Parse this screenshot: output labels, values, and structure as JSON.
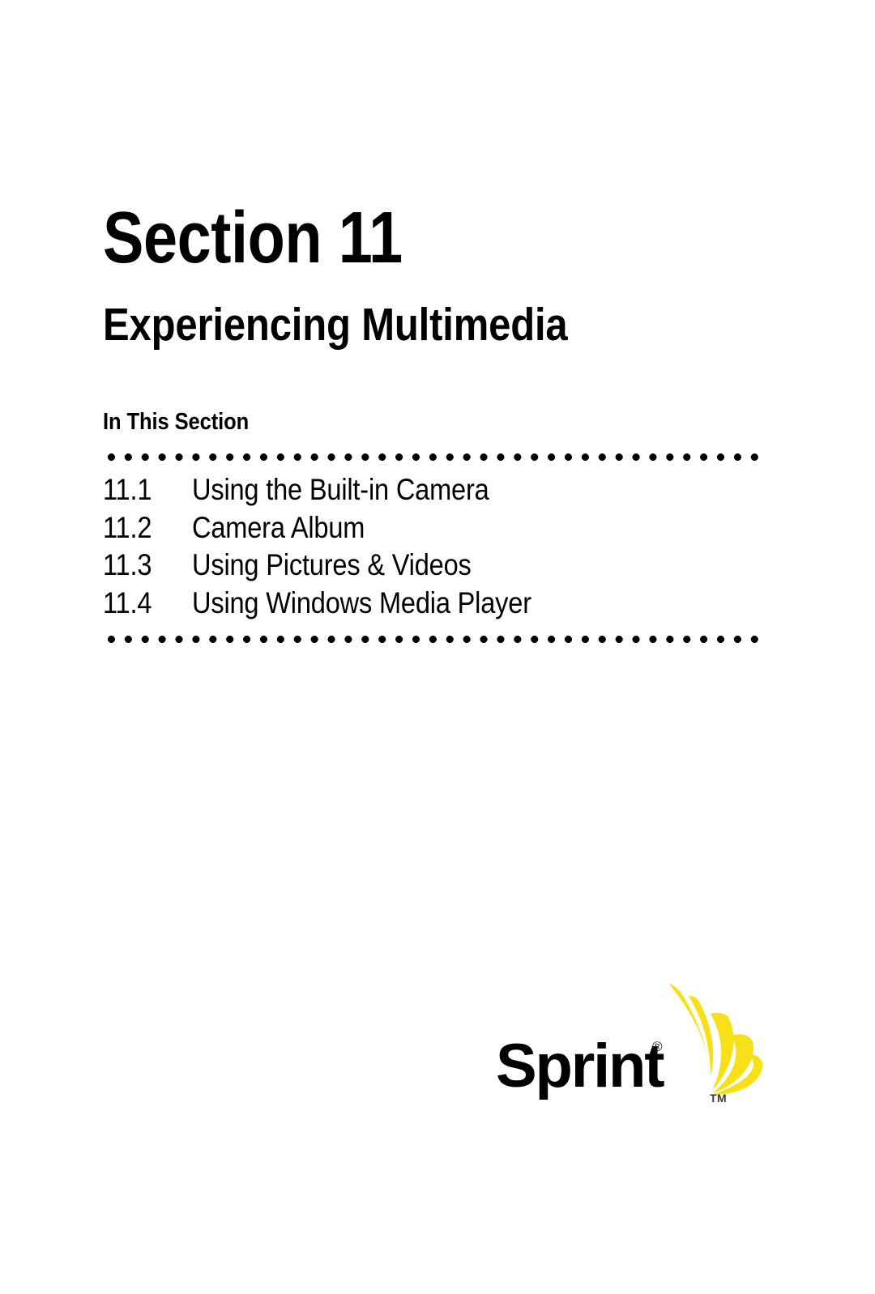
{
  "page": {
    "background_color": "#ffffff",
    "text_color": "#000000"
  },
  "header": {
    "section_title": "Section 11",
    "section_subtitle": "Experiencing Multimedia"
  },
  "contents": {
    "heading": "In This Section",
    "items": [
      {
        "number": "11.1",
        "title": "Using the Built-in Camera"
      },
      {
        "number": "11.2",
        "title": "Camera Album"
      },
      {
        "number": "11.3",
        "title": "Using Pictures & Videos"
      },
      {
        "number": "11.4",
        "title": "Using Windows Media Player"
      }
    ]
  },
  "logo": {
    "wordmark": "Sprint",
    "registered_symbol": "®",
    "trademark_symbol": "TM",
    "mark_color": "#F7E017",
    "wordmark_color": "#000000"
  }
}
